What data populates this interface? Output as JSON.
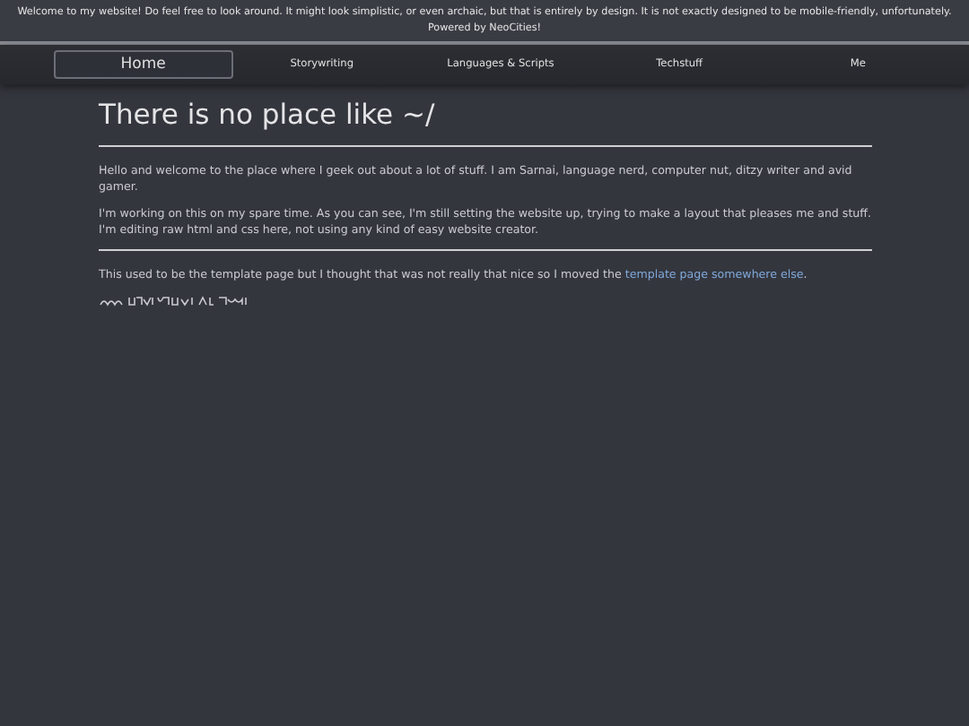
{
  "banner": {
    "lines": [
      "Welcome to my website! Do feel free to look around. It might look simplistic, or even archaic, but that is entirely by design. It is not exactly designed to be mobile-friendly, unfortunately.",
      "Powered by NeoCities!"
    ]
  },
  "nav": [
    {
      "label": "Home",
      "selected": true
    },
    {
      "label": "Storywriting",
      "selected": false
    },
    {
      "label": "Languages & Scripts",
      "selected": false
    },
    {
      "label": "Techstuff",
      "selected": false
    },
    {
      "label": "Me",
      "selected": false
    }
  ],
  "heading": "There is no place like ~/",
  "paragraphs": [
    "Hello and welcome to the place where I geek out about a lot of stuff. I am Sarnai, language nerd, computer nut, ditzy writer and avid gamer.",
    "I'm working on this on my spare time. As you can see, I'm still setting the website up, trying to make a layout that pleases me and stuff. I'm editing raw html and css here, not using any kind of easy website creator."
  ],
  "note": {
    "before": "This used to be the template page but I thought that was not really that nice so I moved the ",
    "link": "template page somewhere else",
    "after": "."
  }
}
